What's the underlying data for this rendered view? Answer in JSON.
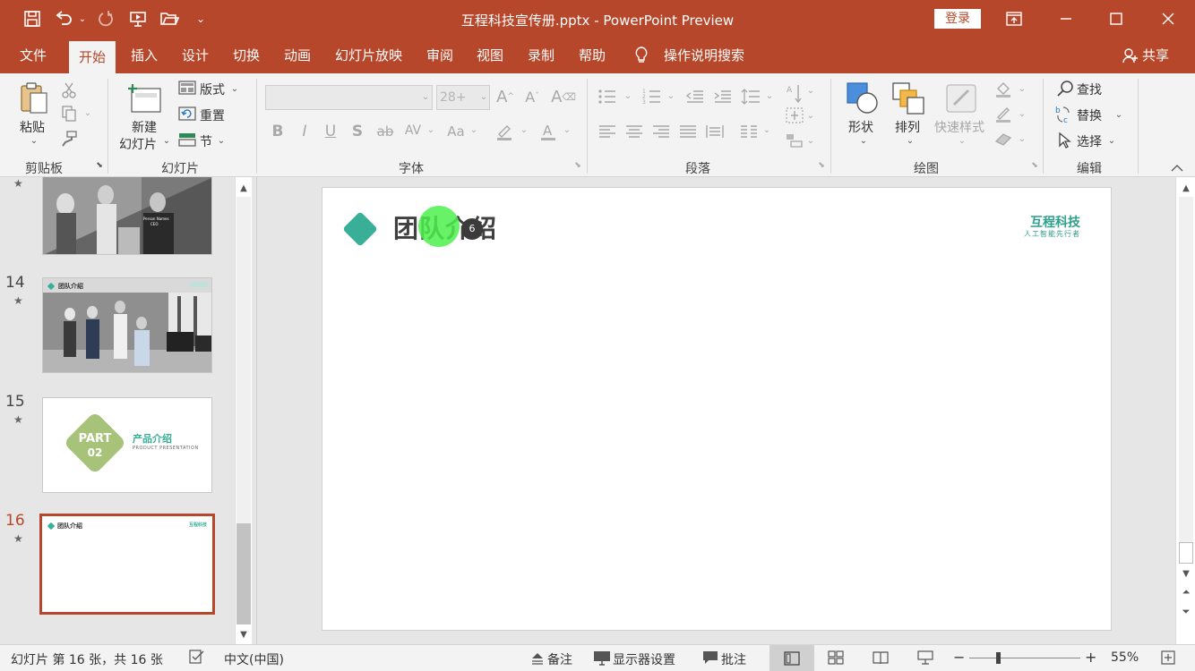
{
  "window": {
    "title": "互程科技宣传册.pptx  -  PowerPoint Preview",
    "login_label": "登录"
  },
  "menu": {
    "tabs": [
      "文件",
      "开始",
      "插入",
      "设计",
      "切换",
      "动画",
      "幻灯片放映",
      "审阅",
      "视图",
      "录制",
      "帮助"
    ],
    "active_tab": "开始",
    "tell_me": "操作说明搜索",
    "share": "共享"
  },
  "ribbon": {
    "clipboard": {
      "paste": "粘贴",
      "label": "剪贴板"
    },
    "slides": {
      "new_slide_1": "新建",
      "new_slide_2": "幻灯片",
      "layout": "版式",
      "reset": "重置",
      "section": "节",
      "label": "幻灯片"
    },
    "font": {
      "size_value": "28+",
      "label": "字体"
    },
    "paragraph": {
      "label": "段落"
    },
    "drawing": {
      "shapes": "形状",
      "arrange": "排列",
      "quick_styles": "快速样式",
      "label": "绘图"
    },
    "editing": {
      "find": "查找",
      "replace": "替换",
      "select": "选择",
      "label": "编辑"
    }
  },
  "thumbnails": {
    "numbers": [
      "14",
      "15",
      "16"
    ],
    "slide14_title": "团队介绍",
    "slide15_part": "PART",
    "slide15_part_num": "02",
    "slide15_title": "产品介绍",
    "slide15_sub": "PRODUCT PRESENTATION",
    "slide16_title": "团队介绍",
    "slide16_logo": "互程科技",
    "partial_caption_name": "Person Names",
    "partial_caption_role": "CEO"
  },
  "slide": {
    "title": "团队介绍",
    "logo_main": "互程科技",
    "logo_sub": "人工智能先行者",
    "cursor_badge": "6"
  },
  "status": {
    "slide_info": "幻灯片 第 16 张，共 16 张",
    "language": "中文(中国)",
    "notes": "备注",
    "display_settings": "显示器设置",
    "comments": "批注",
    "zoom": "55%"
  },
  "colors": {
    "brand": "#b7472a",
    "accent_teal": "#3aaf98",
    "accent_green": "#a7c37a",
    "cursor_highlight": "#4df04d"
  }
}
